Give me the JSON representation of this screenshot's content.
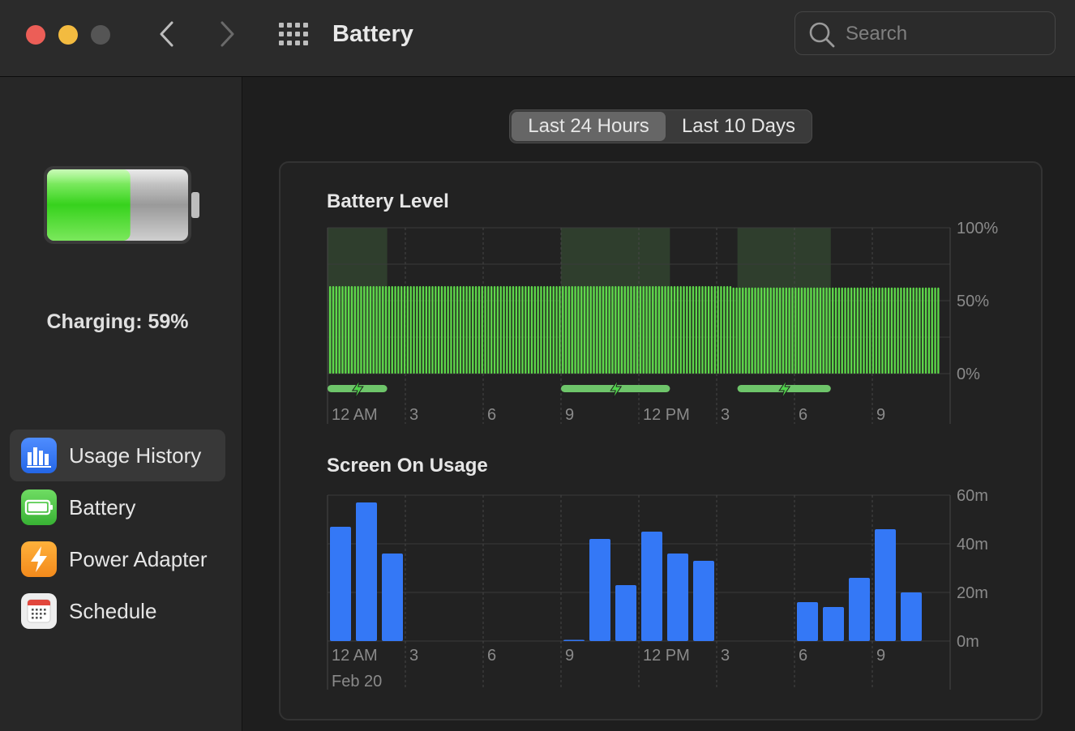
{
  "window": {
    "title": "Battery"
  },
  "search": {
    "placeholder": "Search"
  },
  "status": {
    "charging_text": "Charging: 59%",
    "battery_level_fraction": 0.59
  },
  "sidebar": {
    "items": [
      {
        "label": "Usage History",
        "icon": "bar-chart-icon",
        "selected": true
      },
      {
        "label": "Battery",
        "icon": "battery-icon"
      },
      {
        "label": "Power Adapter",
        "icon": "lightning-bolt-icon"
      },
      {
        "label": "Schedule",
        "icon": "calendar-icon"
      }
    ]
  },
  "tabs": [
    {
      "label": "Last 24 Hours",
      "selected": true
    },
    {
      "label": "Last 10 Days"
    }
  ],
  "colors": {
    "level_bar": "#5ed84a",
    "usage_bar": "#3478f6",
    "charging_band": "#6ec56a",
    "charging_bg": "#2f3e2d",
    "sidebar_selected": "#383838"
  },
  "chart_data": [
    {
      "type": "bar",
      "title": "Battery Level",
      "x_ticks": [
        "12 AM",
        "3",
        "6",
        "9",
        "12 PM",
        "3",
        "6",
        "9"
      ],
      "y_ticks": [
        "100%",
        "50%",
        "0%"
      ],
      "ylim": [
        0,
        100
      ],
      "series": [
        {
          "values": [
            60,
            60,
            60,
            60,
            60,
            60,
            60,
            60,
            60,
            60,
            60,
            60,
            60,
            60,
            60,
            60,
            60,
            60,
            60,
            60,
            60,
            60,
            60,
            60,
            60,
            60,
            60,
            60,
            60,
            60,
            60,
            60,
            60,
            60,
            60,
            60,
            60,
            60,
            60,
            60,
            60,
            60,
            60,
            60,
            60,
            60,
            60,
            60,
            60,
            60,
            60,
            60,
            60,
            60,
            60,
            60,
            60,
            60,
            60,
            60,
            60,
            60,
            60,
            60,
            60,
            60,
            60,
            60,
            60,
            60,
            60,
            60,
            60,
            60,
            60,
            60,
            60,
            60,
            60,
            60,
            60,
            60,
            60,
            60,
            60,
            60,
            60,
            60,
            60,
            60,
            60,
            60,
            60,
            60,
            60,
            60,
            60,
            60,
            60,
            60,
            60,
            60,
            60,
            60,
            60,
            60,
            60,
            60,
            60,
            60,
            60,
            60,
            60,
            60,
            60,
            60,
            60,
            60,
            60,
            60,
            60,
            60,
            60,
            60,
            60,
            60,
            60,
            60,
            60,
            60,
            59,
            59,
            59,
            59,
            59,
            59,
            59,
            59,
            59,
            59,
            59,
            59,
            59,
            59,
            59,
            59,
            59,
            59,
            59,
            59,
            59,
            59,
            59,
            59,
            59,
            59,
            59,
            59,
            59,
            59,
            59,
            59,
            59,
            59,
            59,
            59,
            59,
            59,
            59,
            59,
            59,
            59,
            59,
            59,
            59,
            59,
            59,
            59,
            59,
            59,
            59,
            59,
            59,
            59,
            59,
            59,
            59,
            59,
            59,
            59,
            59,
            59,
            59,
            59,
            59,
            59,
            59
          ]
        }
      ],
      "charging_ranges_hours": [
        [
          0,
          2.3
        ],
        [
          9,
          13.2
        ],
        [
          15.8,
          19.4
        ]
      ],
      "legend": "none"
    },
    {
      "type": "bar",
      "title": "Screen On Usage",
      "x_ticks": [
        "12 AM",
        "3",
        "6",
        "9",
        "12 PM",
        "3",
        "6",
        "9"
      ],
      "x_sub": "Feb 20",
      "y_ticks": [
        "60m",
        "40m",
        "20m",
        "0m"
      ],
      "ylim": [
        0,
        60
      ],
      "values": [
        47,
        57,
        36,
        0,
        0,
        0,
        0,
        0,
        0,
        0.5,
        42,
        23,
        45,
        36,
        33,
        0,
        0,
        0,
        16,
        14,
        26,
        46,
        20
      ],
      "legend": "none"
    }
  ]
}
